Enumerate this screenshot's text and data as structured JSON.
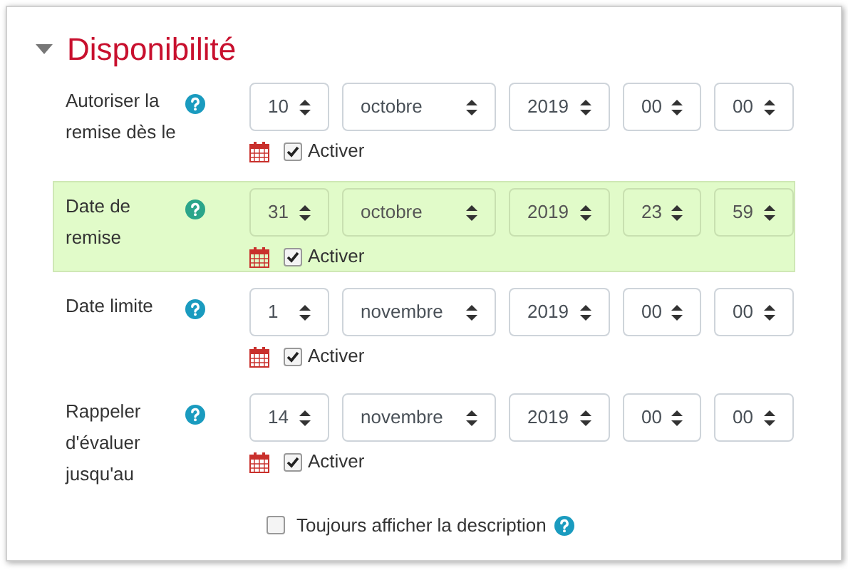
{
  "section": {
    "title": "Disponibilité",
    "expanded": true
  },
  "rows": [
    {
      "label": "Autoriser la remise dès le",
      "highlighted": false,
      "day": "10",
      "month": "octobre",
      "year": "2019",
      "hour": "00",
      "minute": "00",
      "enable_label": "Activer",
      "enabled": true
    },
    {
      "label": "Date de remise",
      "highlighted": true,
      "day": "31",
      "month": "octobre",
      "year": "2019",
      "hour": "23",
      "minute": "59",
      "enable_label": "Activer",
      "enabled": true
    },
    {
      "label": "Date limite",
      "highlighted": false,
      "day": "1",
      "month": "novembre",
      "year": "2019",
      "hour": "00",
      "minute": "00",
      "enable_label": "Activer",
      "enabled": true
    },
    {
      "label": "Rappeler d'évaluer jusqu'au",
      "highlighted": false,
      "day": "14",
      "month": "novembre",
      "year": "2019",
      "hour": "00",
      "minute": "00",
      "enable_label": "Activer",
      "enabled": true
    }
  ],
  "always_show_description": {
    "label": "Toujours afficher la description",
    "checked": false
  }
}
